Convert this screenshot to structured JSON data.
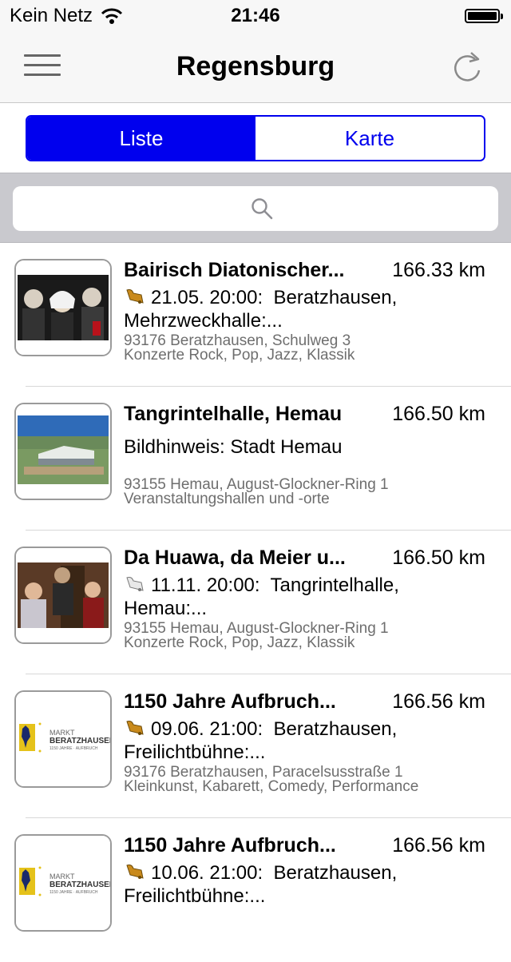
{
  "status": {
    "carrier": "Kein Netz",
    "time": "21:46"
  },
  "nav": {
    "title": "Regensburg",
    "menu_icon": "hamburger-menu-icon",
    "refresh_icon": "refresh-icon"
  },
  "segments": {
    "list": "Liste",
    "map": "Karte",
    "active": "Liste"
  },
  "search": {
    "placeholder": ""
  },
  "colors": {
    "accent": "#0000ee",
    "search_bg": "#c9c9ce",
    "secondary_text": "#6e6e6e"
  },
  "items": [
    {
      "title": "Bairisch Diatonischer...",
      "distance": "166.33 km",
      "date": "21.05. 20:00:",
      "location": "Beratzhausen, Mehrzweckhalle:...",
      "address": "93176 Beratzhausen, Schulweg 3",
      "category": "Konzerte Rock, Pop, Jazz, Klassik"
    },
    {
      "title": "Tangrintelhalle, Hemau",
      "distance": "166.50 km",
      "description": "Bildhinweis: Stadt Hemau",
      "address": "93155 Hemau, August-Glockner-Ring 1",
      "category": "Veranstaltungshallen und -orte"
    },
    {
      "title": "Da Huawa, da Meier u...",
      "distance": "166.50 km",
      "date": "11.11. 20:00:",
      "location": "Tangrintelhalle, Hemau:...",
      "address": "93155 Hemau, August-Glockner-Ring 1",
      "category": "Konzerte Rock, Pop, Jazz, Klassik"
    },
    {
      "title": "1150 Jahre Aufbruch...",
      "distance": "166.56 km",
      "date": "09.06. 21:00:",
      "location": "Beratzhausen, Freilichtbühne:...",
      "address": "93176 Beratzhausen, Paracelsusstraße 1",
      "category": "Kleinkunst, Kabarett, Comedy, Performance",
      "logo": {
        "line1": "MARKT",
        "line2": "BERATZHAUSEN",
        "line3": "1150 JAHRE · AUFBRUCH"
      }
    },
    {
      "title": "1150 Jahre Aufbruch...",
      "distance": "166.56 km",
      "date": "10.06. 21:00:",
      "location": "Beratzhausen, Freilichtbühne:...",
      "logo": {
        "line1": "MARKT",
        "line2": "BERATZHAUSEN",
        "line3": "1150 JAHRE · AUFBRUCH"
      }
    }
  ]
}
